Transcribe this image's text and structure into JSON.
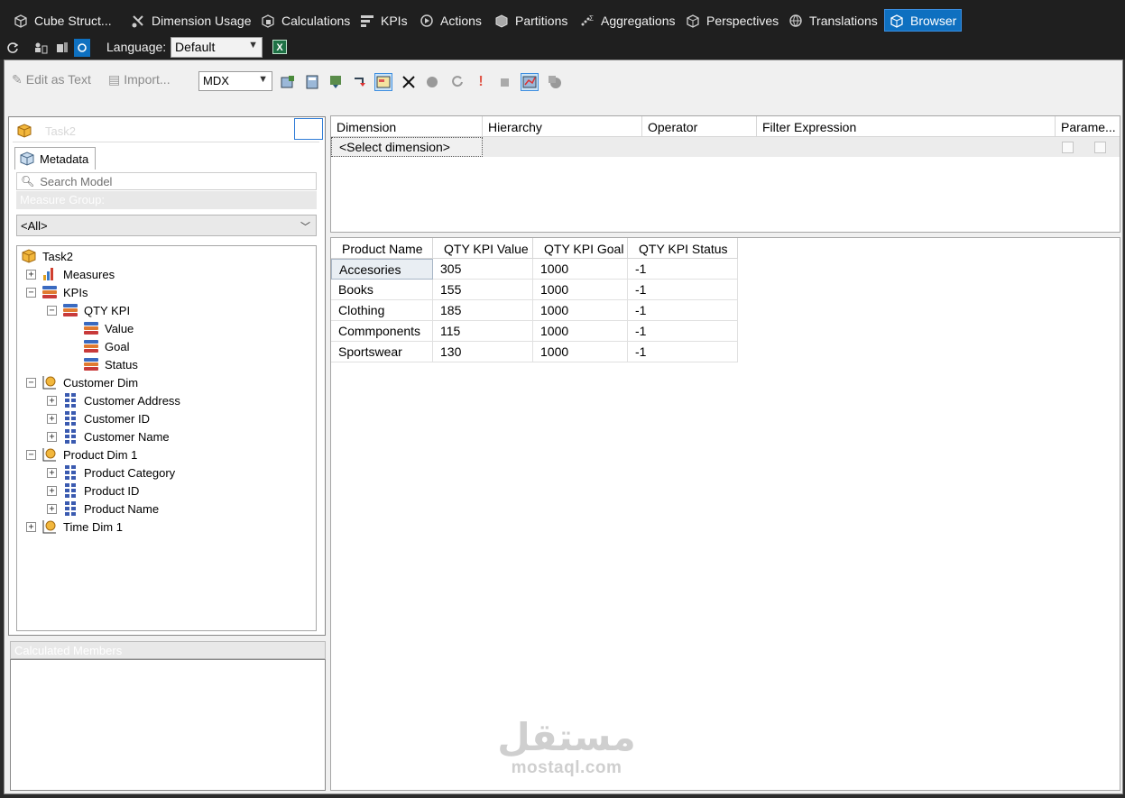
{
  "tabs": [
    {
      "label": "Cube Struct...",
      "icon": "cube-structure-icon"
    },
    {
      "label": "Dimension Usage",
      "icon": "dimension-usage-icon"
    },
    {
      "label": "Calculations",
      "icon": "calculations-icon"
    },
    {
      "label": "KPIs",
      "icon": "kpis-icon"
    },
    {
      "label": "Actions",
      "icon": "actions-icon"
    },
    {
      "label": "Partitions",
      "icon": "partitions-icon"
    },
    {
      "label": "Aggregations",
      "icon": "aggregations-icon"
    },
    {
      "label": "Perspectives",
      "icon": "perspectives-icon"
    },
    {
      "label": "Translations",
      "icon": "translations-icon"
    },
    {
      "label": "Browser",
      "icon": "browser-icon",
      "active": true
    }
  ],
  "language": {
    "label": "Language:",
    "value": "Default"
  },
  "query_toolbar": {
    "edit_as_text": "Edit as Text",
    "import": "Import...",
    "query_type": "MDX"
  },
  "left_panel": {
    "cube_name": "Task2",
    "metadata_tab": "Metadata",
    "search_placeholder": "Search Model",
    "measure_group_label": "Measure Group:",
    "measure_group_value": "<All>",
    "calculated_members_label": "Calculated Members"
  },
  "tree": {
    "root": "Task2",
    "measures": "Measures",
    "kpis": "KPIs",
    "qty_kpi": "QTY KPI",
    "value": "Value",
    "goal": "Goal",
    "status": "Status",
    "customer_dim": "Customer Dim",
    "customer_address": "Customer Address",
    "customer_id": "Customer ID",
    "customer_name": "Customer Name",
    "product_dim": "Product Dim 1",
    "product_category": "Product Category",
    "product_id": "Product ID",
    "product_name": "Product Name",
    "time_dim": "Time Dim 1"
  },
  "filter": {
    "columns": [
      "Dimension",
      "Hierarchy",
      "Operator",
      "Filter Expression",
      "Parame..."
    ],
    "select_dimension": "<Select dimension>"
  },
  "results": {
    "columns": [
      "Product Name",
      "QTY KPI Value",
      "QTY KPI Goal",
      "QTY KPI Status"
    ],
    "rows": [
      [
        "Accesories",
        "305",
        "1000",
        "-1"
      ],
      [
        "Books",
        "155",
        "1000",
        "-1"
      ],
      [
        "Clothing",
        "185",
        "1000",
        "-1"
      ],
      [
        "Commponents",
        "115",
        "1000",
        "-1"
      ],
      [
        "Sportswear",
        "130",
        "1000",
        "-1"
      ]
    ]
  },
  "watermark": {
    "arabic": "مستقل",
    "latin": "mostaql.com"
  },
  "colors": {
    "accent": "#0e70c0",
    "dark_bg": "#1f1f1f",
    "panel_bg": "#f0f0f0"
  }
}
